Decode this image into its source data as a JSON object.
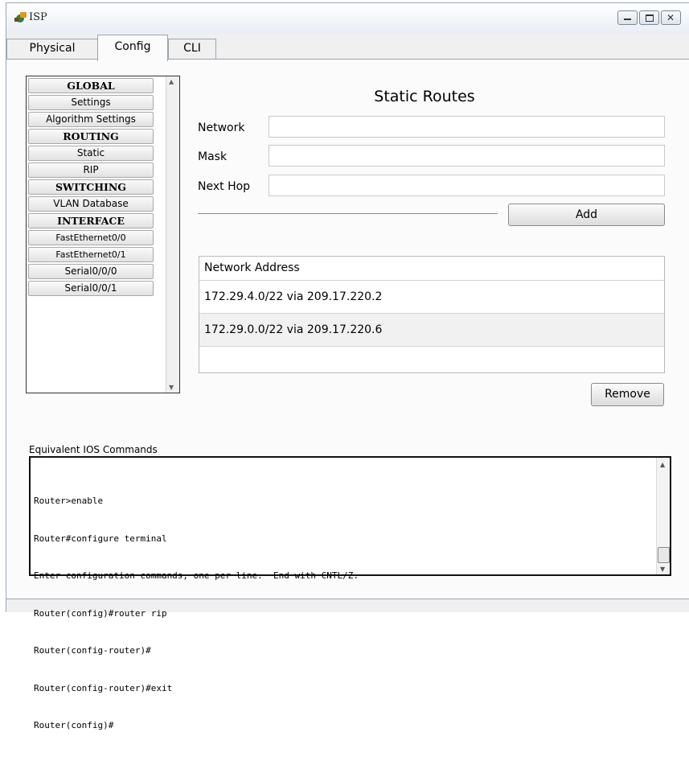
{
  "window": {
    "title": "ISP",
    "close_glyph": "✕"
  },
  "tabs": [
    {
      "label": "Physical"
    },
    {
      "label": "Config"
    },
    {
      "label": "CLI"
    }
  ],
  "sidebar": {
    "items": [
      {
        "label": "GLOBAL"
      },
      {
        "label": "Settings"
      },
      {
        "label": "Algorithm Settings"
      },
      {
        "label": "ROUTING"
      },
      {
        "label": "Static"
      },
      {
        "label": "RIP"
      },
      {
        "label": "SWITCHING"
      },
      {
        "label": "VLAN Database"
      },
      {
        "label": "INTERFACE"
      },
      {
        "label": "FastEthernet0/0"
      },
      {
        "label": "FastEthernet0/1"
      },
      {
        "label": "Serial0/0/0"
      },
      {
        "label": "Serial0/0/1"
      }
    ]
  },
  "static_routes": {
    "title": "Static Routes",
    "network_label": "Network",
    "network_value": "",
    "mask_label": "Mask",
    "mask_value": "",
    "next_hop_label": "Next Hop",
    "next_hop_value": "",
    "add_label": "Add",
    "table_header": "Network Address",
    "routes": [
      "172.29.4.0/22 via 209.17.220.2",
      "172.29.0.0/22 via 209.17.220.6"
    ],
    "remove_label": "Remove"
  },
  "ios": {
    "label": "Equivalent IOS Commands",
    "lines": [
      "Router>enable",
      "Router#configure terminal",
      "Enter configuration commands, one per line.  End with CNTL/Z.",
      "Router(config)#router rip",
      "Router(config-router)#",
      "Router(config-router)#exit",
      "Router(config)#"
    ]
  },
  "scroll_glyphs": {
    "up": "▲",
    "down": "▼"
  },
  "colors": {
    "window_bg": "#f0f0f0",
    "panel_bg": "#fbfbfb",
    "border": "#9aa4b0"
  }
}
